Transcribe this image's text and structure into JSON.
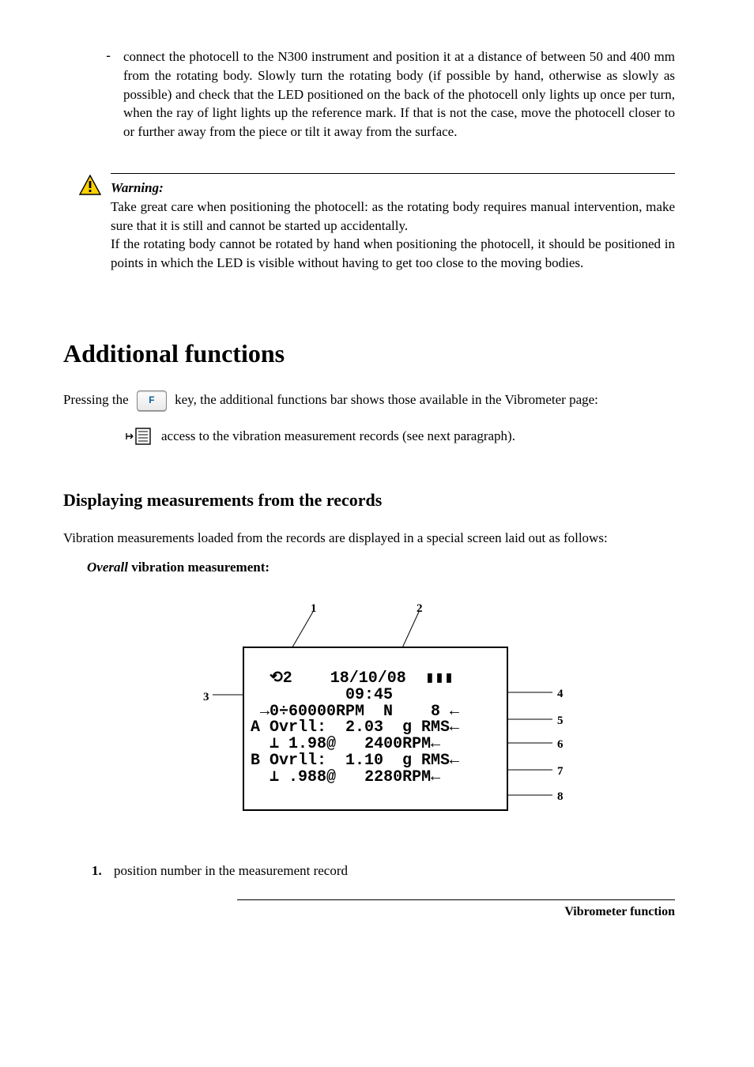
{
  "bullet": {
    "dash": "-",
    "text": "connect the photocell to the N300 instrument and position it at a distance of between 50 and 400 mm from the rotating body. Slowly turn the rotating body (if possible by hand, otherwise as slowly as possible) and check that the LED positioned on the back of the photocell only lights up once per turn, when the ray of light lights up the reference mark. If that is not the case, move the photocell closer to or further away from the piece or tilt it away from the surface."
  },
  "warning": {
    "title": "Warning:",
    "line1": "Take great care when positioning the photocell:  as the rotating body requires manual intervention, make sure that it is still and cannot be started up accidentally.",
    "line2": "If the rotating body cannot be rotated by hand when positioning the photocell, it should be positioned in points in which the LED is visible without having to get too close to the moving bodies."
  },
  "heading1": "Additional functions",
  "pressing": {
    "pre": "Pressing the ",
    "keylabel": "F",
    "post": " key, the additional functions bar shows those available in the Vibrometer page:"
  },
  "records_access": "access to the vibration measurement records (see next paragraph).",
  "heading2": "Displaying measurements from the records",
  "records_intro": "Vibration measurements loaded from the records are displayed in a special screen laid out as follows:",
  "overall_label_italic": "Overall",
  "overall_label_rest": " vibration measurement:",
  "figure": {
    "callouts": {
      "c1": "1",
      "c2": "2",
      "c3": "3",
      "c4": "4",
      "c5": "5",
      "c6": "6",
      "c7": "7",
      "c8": "8"
    },
    "lcd": {
      "row1": "  ⟲2    18/10/08  ▮▮▮",
      "row2": "          09:45",
      "row3": " →0÷60000RPM  N    8 ←",
      "row4": "A Ovrll:  2.03  g RMS←",
      "row5": "  ⊥ 1.98@   2400RPM←",
      "row6": "B Ovrll:  1.10  g RMS←",
      "row7": "  ⊥ .988@   2280RPM←"
    }
  },
  "list": {
    "n1": "1.",
    "t1": "position number in the measurement record"
  },
  "footer": "Vibrometer function"
}
